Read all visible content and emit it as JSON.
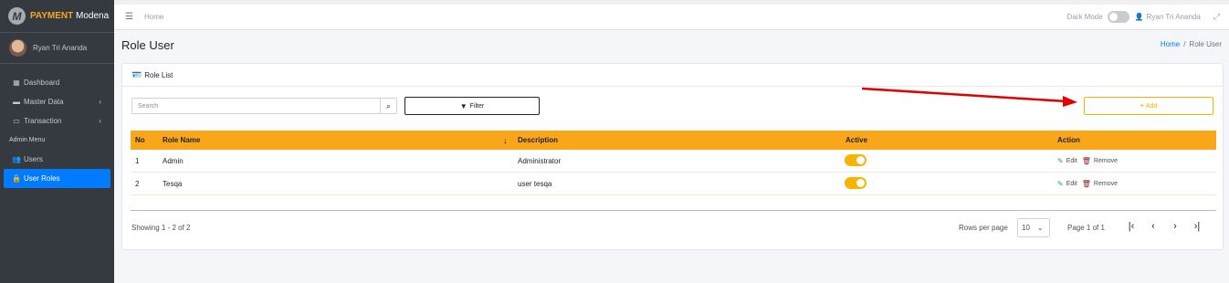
{
  "brand": {
    "logo_letter": "M",
    "name_bold": "PAYMENT",
    "name_rest": "Modena"
  },
  "user": {
    "name": "Ryan Tri Ananda"
  },
  "sidebar": {
    "items": [
      {
        "label": "Dashboard",
        "icon": "grid-icon"
      },
      {
        "label": "Master Data",
        "icon": "database-icon",
        "has_chevron": true
      },
      {
        "label": "Transaction",
        "icon": "card-icon",
        "has_chevron": true
      }
    ],
    "admin_header": "Admin Menu",
    "admin_items": [
      {
        "label": "Users",
        "icon": "users-icon"
      },
      {
        "label": "User Roles",
        "icon": "lock-icon",
        "active": true
      }
    ]
  },
  "topbar": {
    "home": "Home",
    "dark_mode": "Dark Mode",
    "user": "Ryan Tri Ananda"
  },
  "page": {
    "title": "Role User",
    "breadcrumb_home": "Home",
    "breadcrumb_sep": "/",
    "breadcrumb_current": "Role User"
  },
  "card": {
    "title": "Role List",
    "search_placeholder": "Search",
    "filter_label": "Filter",
    "add_label": "Add"
  },
  "table": {
    "headers": {
      "no": "No",
      "role_name": "Role Name",
      "description": "Description",
      "active": "Active",
      "action": "Action"
    },
    "rows": [
      {
        "no": "1",
        "role_name": "Admin",
        "description": "Administrator",
        "active": true,
        "edit": "Edit",
        "remove": "Remove"
      },
      {
        "no": "2",
        "role_name": "Tesqa",
        "description": "user tesqa",
        "active": true,
        "edit": "Edit",
        "remove": "Remove"
      }
    ]
  },
  "footer": {
    "showing": "Showing 1 - 2 of 2",
    "rows_per_page_label": "Rows per page",
    "rows_per_page": "10",
    "page_info": "Page 1 of 1"
  },
  "colors": {
    "accent": "#f9a61a",
    "sidebar": "#343a40",
    "active_nav": "#007bff",
    "annotation": "#e00000"
  }
}
